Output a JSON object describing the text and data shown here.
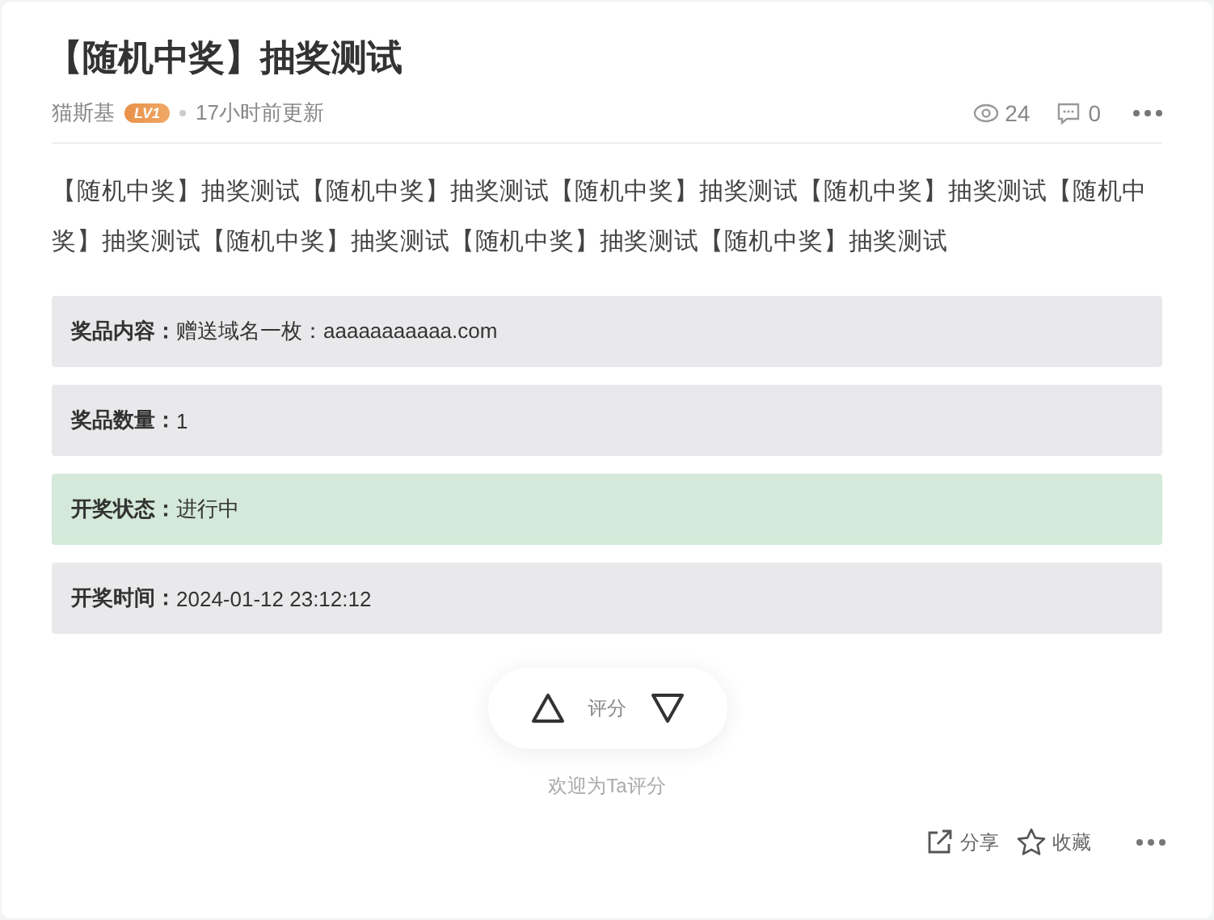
{
  "title": "【随机中奖】抽奖测试",
  "meta": {
    "author": "猫斯基",
    "level_badge": "LV1",
    "updated": "17小时前更新",
    "views": "24",
    "comments": "0"
  },
  "body": "【随机中奖】抽奖测试【随机中奖】抽奖测试【随机中奖】抽奖测试【随机中奖】抽奖测试【随机中奖】抽奖测试【随机中奖】抽奖测试【随机中奖】抽奖测试【随机中奖】抽奖测试",
  "info_rows": [
    {
      "kind": "info",
      "label": "奖品内容：",
      "value": "赠送域名一枚：aaaaaaaaaaa.com"
    },
    {
      "kind": "info",
      "label": "奖品数量：",
      "value": "1"
    },
    {
      "kind": "success",
      "label": "开奖状态：",
      "value": "进行中"
    },
    {
      "kind": "info",
      "label": "开奖时间：",
      "value": "2024-01-12 23:12:12"
    }
  ],
  "rating": {
    "label": "评分",
    "hint": "欢迎为Ta评分"
  },
  "footer": {
    "share": "分享",
    "favorite": "收藏"
  }
}
